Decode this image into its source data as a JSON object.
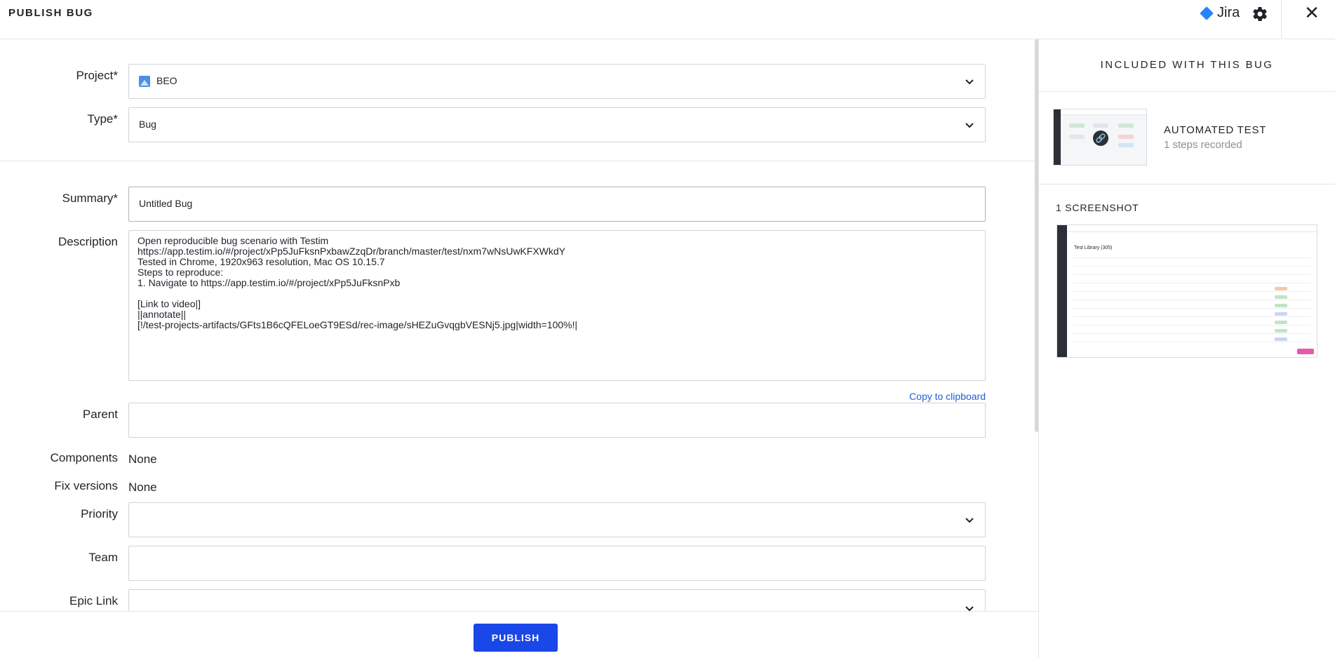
{
  "header": {
    "title": "PUBLISH BUG",
    "integration_label": "Jira",
    "close_glyph": "✕"
  },
  "form": {
    "project": {
      "label": "Project*",
      "value": "BEO"
    },
    "type": {
      "label": "Type*",
      "value": "Bug"
    },
    "summary": {
      "label": "Summary*",
      "value": "Untitled Bug"
    },
    "description": {
      "label": "Description",
      "value": "Open reproducible bug scenario with Testim\nhttps://app.testim.io/#/project/xPp5JuFksnPxbawZzqDr/branch/master/test/nxm7wNsUwKFXWkdY\nTested in Chrome, 1920x963 resolution, Mac OS 10.15.7\nSteps to reproduce:\n1. Navigate to https://app.testim.io/#/project/xPp5JuFksnPxb\n\n[Link to video|]\n||annotate||\n[!/test-projects-artifacts/GFts1B6cQFELoeGT9ESd/rec-image/sHEZuGvqgbVESNj5.jpg|width=100%!|",
      "copy_label": "Copy to clipboard"
    },
    "parent": {
      "label": "Parent",
      "value": ""
    },
    "components": {
      "label": "Components",
      "value": "None"
    },
    "fix_versions": {
      "label": "Fix versions",
      "value": "None"
    },
    "priority": {
      "label": "Priority",
      "value": ""
    },
    "team": {
      "label": "Team",
      "value": ""
    },
    "epic_link": {
      "label": "Epic Link",
      "value": ""
    }
  },
  "footer": {
    "publish_label": "PUBLISH"
  },
  "panel": {
    "heading": "INCLUDED WITH THIS BUG",
    "test": {
      "title": "AUTOMATED TEST",
      "subtitle": "1 steps recorded"
    },
    "screenshot_heading": "1 SCREENSHOT",
    "screenshot_title": "Test Library (305)"
  },
  "colors": {
    "accent": "#1a47e8",
    "link": "#1f5fd6",
    "jira_brand": "#2684ff"
  }
}
